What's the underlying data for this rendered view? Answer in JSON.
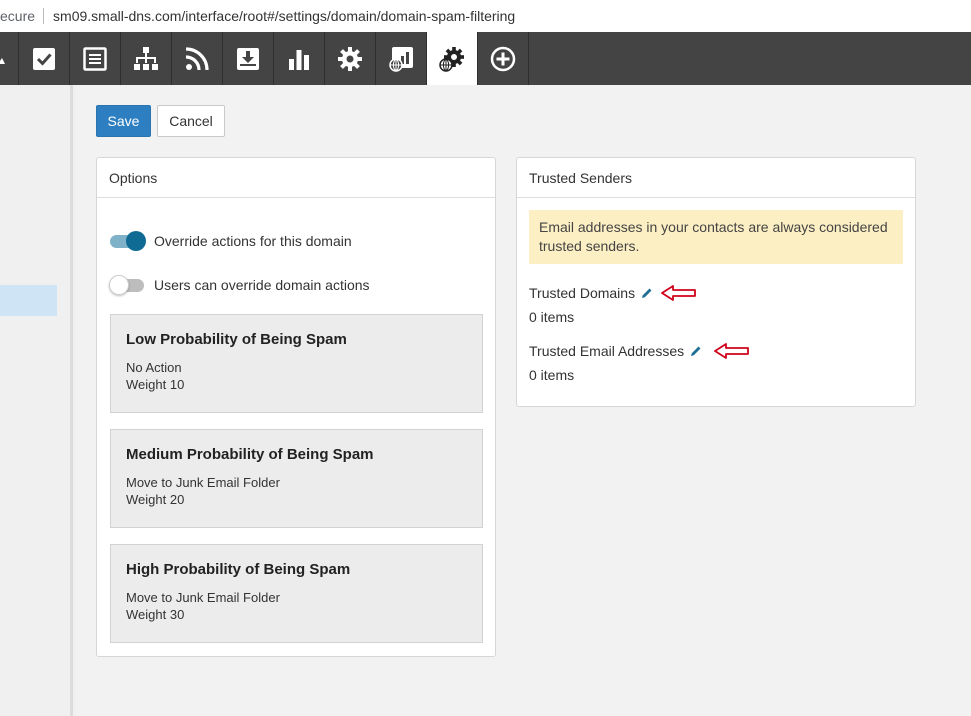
{
  "browser": {
    "security_text": "ecure",
    "url": "sm09.small-dns.com/interface/root#/settings/domain/domain-spam-filtering"
  },
  "toolbar": {
    "items": [
      {
        "icon": "partial-icon"
      },
      {
        "icon": "tasks-icon"
      },
      {
        "icon": "notes-icon"
      },
      {
        "icon": "sitemap-icon"
      },
      {
        "icon": "rss-icon"
      },
      {
        "icon": "inbox-download-icon"
      },
      {
        "icon": "bar-chart-icon"
      },
      {
        "icon": "gear-icon"
      },
      {
        "icon": "domain-reports-icon"
      },
      {
        "icon": "domain-settings-icon",
        "active": true
      },
      {
        "icon": "add-circle-icon"
      }
    ]
  },
  "actions": {
    "save_label": "Save",
    "cancel_label": "Cancel"
  },
  "options": {
    "header": "Options",
    "override_toggle": {
      "label": "Override actions for this domain",
      "on": true
    },
    "user_override_toggle": {
      "label": "Users can override domain actions",
      "on": false
    },
    "cards": [
      {
        "title": "Low Probability of Being Spam",
        "action": "No Action",
        "weight": "Weight 10"
      },
      {
        "title": "Medium Probability of Being Spam",
        "action": "Move to Junk Email Folder",
        "weight": "Weight 20"
      },
      {
        "title": "High Probability of Being Spam",
        "action": "Move to Junk Email Folder",
        "weight": "Weight 30"
      }
    ]
  },
  "trusted_senders": {
    "header": "Trusted Senders",
    "notice": "Email addresses in your contacts are always considered trusted senders.",
    "domains": {
      "label": "Trusted Domains",
      "count": "0 items"
    },
    "emails": {
      "label": "Trusted Email Addresses",
      "count": "0 items"
    }
  },
  "colors": {
    "toolbar_bg": "#444444",
    "primary": "#2d7fc1",
    "toggle_on": "#0f6a94",
    "notice_bg": "#fcefc3",
    "annotation_arrow": "#d0021b"
  }
}
